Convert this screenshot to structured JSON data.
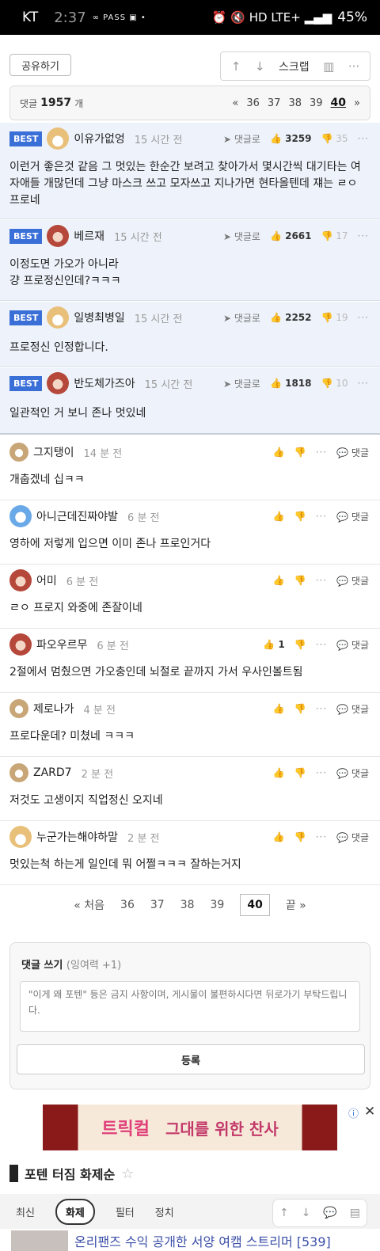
{
  "status": {
    "carrier": "KT",
    "time": "2:37",
    "tiny_icons": "∞ PASS ▣ •",
    "right_icons": "⏰ 🔇 HD LTE+ ▂▄▆",
    "battery": "45%"
  },
  "toolbar": {
    "share_label": "공유하기",
    "up_icon": "↑",
    "down_icon": "↓",
    "scrap_label": "스크랩",
    "stats_icon": "▥",
    "more_icon": "···"
  },
  "count": {
    "label": "댓글",
    "value": "1957",
    "unit": "개",
    "prev": "«",
    "pages": [
      "36",
      "37",
      "38",
      "39"
    ],
    "current": "40",
    "next": "»"
  },
  "best_comments": [
    {
      "badge": "BEST",
      "nick": "이유가없엉",
      "time": "15 시간 전",
      "reply": "댓글로",
      "likes": "3259",
      "dislikes": "35",
      "body": "이런거 좋은것 같음 그 멋있는 한순간 보려고 찾아가서 몇시간씩 대기타는 여자애들 개많던데 그냥 마스크 쓰고 모자쓰고 지나가면 현타올텐데 쟤는 ㄹㅇ 프로네"
    },
    {
      "badge": "BEST",
      "nick": "베르재",
      "time": "15 시간 전",
      "reply": "댓글로",
      "likes": "2661",
      "dislikes": "17",
      "body_line1": "이정도면 가오가 아니라",
      "body_line2": "걍 프로정신인데?ㅋㅋㅋ"
    },
    {
      "badge": "BEST",
      "nick": "일병최병일",
      "time": "15 시간 전",
      "reply": "댓글로",
      "likes": "2252",
      "dislikes": "19",
      "body": "프로정신 인정합니다."
    },
    {
      "badge": "BEST",
      "nick": "반도체가즈아",
      "time": "15 시간 전",
      "reply": "댓글로",
      "likes": "1818",
      "dislikes": "10",
      "body": "일관적인 거 보니 존나 멋있네"
    }
  ],
  "comments": [
    {
      "nick": "그지탱이",
      "time": "14 분 전",
      "likes": "",
      "reply": "댓글",
      "body": "개춥겠네 십ㅋㅋ"
    },
    {
      "nick": "아니근데진짜야발",
      "time": "6 분 전",
      "likes": "",
      "reply": "댓글",
      "body": "영하에 저렇게 입으면 이미 존나 프로인거다"
    },
    {
      "nick": "어미",
      "time": "6 분 전",
      "likes": "",
      "reply": "댓글",
      "body": "ㄹㅇ 프로지 와중에 존잘이네"
    },
    {
      "nick": "파오우르무",
      "time": "6 분 전",
      "likes": "1",
      "reply": "댓글",
      "body": "2절에서 멈췄으면 가오충인데 뇌절로 끝까지 가서 우사인볼트됨"
    },
    {
      "nick": "제로나가",
      "time": "4 분 전",
      "likes": "",
      "reply": "댓글",
      "body": "프로다운데? 미쳤네 ㅋㅋㅋ"
    },
    {
      "nick": "ZARD7",
      "time": "2 분 전",
      "likes": "",
      "reply": "댓글",
      "body": "저것도 고생이지 직업정신 오지네"
    },
    {
      "nick": "누군가는해야하말",
      "time": "2 분 전",
      "likes": "",
      "reply": "댓글",
      "body": "멋있는척 하는게 일인데 뭐 어쩔ㅋㅋㅋ 잘하는거지"
    }
  ],
  "pagination": {
    "first": "« 처음",
    "pages": [
      "36",
      "37",
      "38",
      "39"
    ],
    "current": "40",
    "last": "끝 »"
  },
  "write": {
    "title": "댓글 쓰기",
    "subtitle": "(잉여력 +1)",
    "placeholder": "\"이게 왜 포텐\" 등은 금지 사항이며, 게시물이 불편하시다면 뒤로가기 부탁드립니다.",
    "submit_label": "등록"
  },
  "ad": {
    "left_text": "트릭컬",
    "right_text": "그대를 위한 찬사",
    "info": "ⓘ",
    "close": "✕"
  },
  "topic": {
    "title": "포텐 터짐 화제순",
    "star": "☆"
  },
  "tabs": {
    "items": [
      "최신",
      "화제",
      "필터",
      "정치"
    ],
    "active": "화제"
  },
  "floatbar": {
    "up": "↑",
    "down": "↓",
    "comment": "💬",
    "menu": "▤"
  },
  "news": {
    "headline": "온리팬즈 수익 공개한 서양 여캠 스트리머 [539]"
  }
}
